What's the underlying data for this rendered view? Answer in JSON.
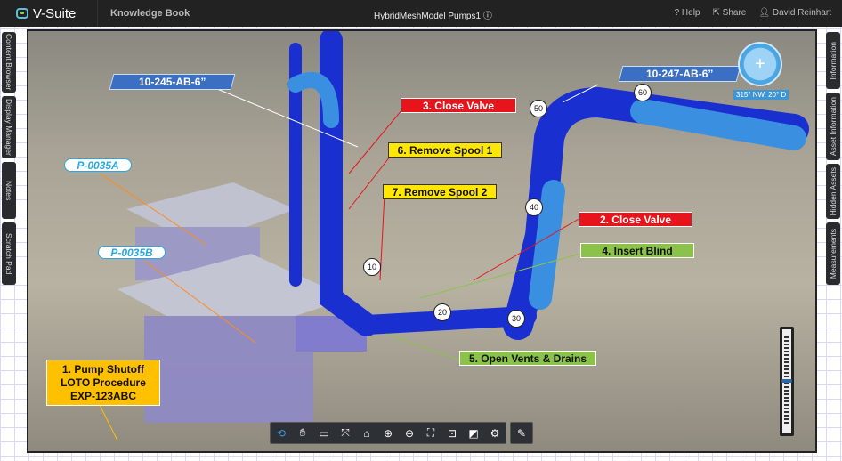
{
  "topbar": {
    "app_name": "V-Suite",
    "knowledge_book": "Knowledge Book",
    "model_title": "HybridMeshModel Pumps1",
    "info_icon": "ⓘ",
    "help": "Help",
    "share": "Share",
    "user": "David Reinhart"
  },
  "left_tabs": [
    "Content Browser",
    "Display Manager",
    "Notes",
    "Scratch Pad"
  ],
  "right_tabs": [
    "Information",
    "Asset Information",
    "Hidden Assets",
    "Measurements"
  ],
  "annotations": {
    "line1": "10-245-AB-6”",
    "line2": "10-247-AB-6”",
    "step3": "3. Close Valve",
    "step6": "6. Remove Spool 1",
    "step7": "7. Remove Spool 2",
    "step2": "2. Close Valve",
    "step4": "4. Insert Blind",
    "step5": "5. Open Vents & Drains",
    "pump_a": "P-0035A",
    "pump_b": "P-0035B",
    "step1": [
      "1.  Pump Shutoff",
      "LOTO Procedure",
      "EXP-123ABC"
    ],
    "markers": [
      "10",
      "20",
      "30",
      "40",
      "50",
      "60"
    ]
  },
  "compass": {
    "readout": "315° NW, 20° D",
    "heading_deg": 315,
    "tilt_deg": 20
  },
  "zoom_slider": {
    "value_fraction": 0.5
  },
  "toolbar": {
    "tools": [
      "orbit",
      "pan",
      "measure",
      "fit-all",
      "home",
      "zoom-in",
      "zoom-out",
      "fullscreen",
      "focus",
      "section",
      "settings",
      "markup"
    ]
  },
  "colors": {
    "pipe": "#1a2fd0",
    "pipe_light": "#3a8fe0",
    "red": "#e8141b",
    "yellow": "#ffe700",
    "green": "#8bc34a",
    "orange": "#ffc000"
  }
}
